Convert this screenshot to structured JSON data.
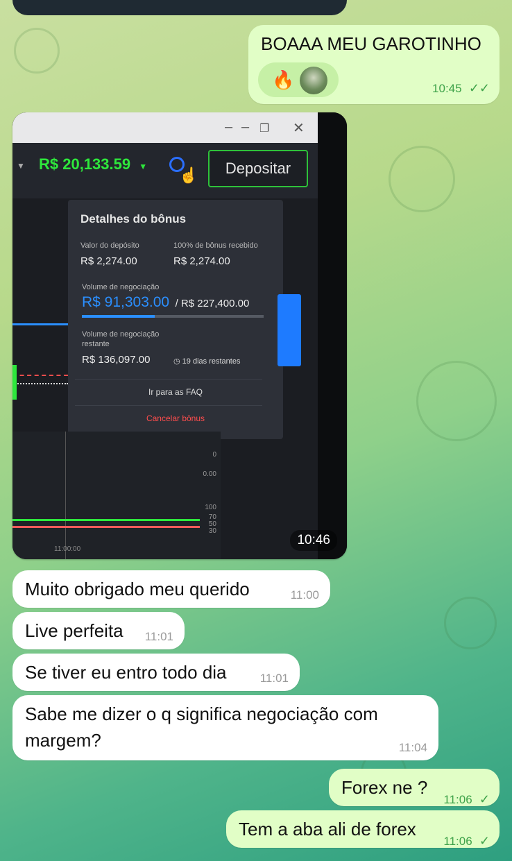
{
  "messages": {
    "msg1": {
      "text": "BOAAA MEU GAROTINHO",
      "time": "10:45",
      "reactions": [
        "fire-emoji",
        "avatar"
      ]
    },
    "photo": {
      "time": "10:46",
      "balance": "R$ 20,133.59",
      "deposit_label": "Depositar",
      "bonus_title": "Detalhes do bônus",
      "deposit_value_label": "Valor do depósito",
      "deposit_value": "R$ 2,274.00",
      "bonus_received_label": "100% de bônus recebido",
      "bonus_received": "R$ 2,274.00",
      "volume_label": "Volume de negociação",
      "volume_done": "R$ 91,303.00",
      "volume_total": "/ R$ 227,400.00",
      "volume_progress": 0.4,
      "remaining_label_1": "Volume de negociação",
      "remaining_label_2": "restante",
      "remaining_value": "R$ 136,097.00",
      "days_left": "19 dias restantes",
      "faq_link": "Ir para as FAQ",
      "cancel_link": "Cancelar bônus",
      "axis_0": "0",
      "axis_000": "0.00",
      "axis_100": "100",
      "axis_70": "70",
      "axis_50": "50",
      "axis_30": "30",
      "time_axis": "11:00:00"
    },
    "msg2": {
      "text": "Muito obrigado meu querido",
      "time": "11:00"
    },
    "msg3": {
      "text": "Live perfeita",
      "time": "11:01"
    },
    "msg4": {
      "text": "Se tiver eu entro todo dia",
      "time": "11:01"
    },
    "msg5": {
      "line1": "Sabe me dizer o q significa negociação com",
      "line2": "margem?",
      "time": "11:04"
    },
    "msg6": {
      "text": "Forex ne ?",
      "time": "11:06"
    },
    "msg7": {
      "text": "Tem a aba ali de forex",
      "time": "11:06"
    }
  },
  "colors": {
    "outgoing_bubble": "#e1fec6",
    "incoming_bubble": "#ffffff",
    "read_check": "#3fa34a",
    "balance_green": "#2ee83c",
    "accent_blue": "#2b8fff",
    "cancel_red": "#ff4d4d"
  }
}
